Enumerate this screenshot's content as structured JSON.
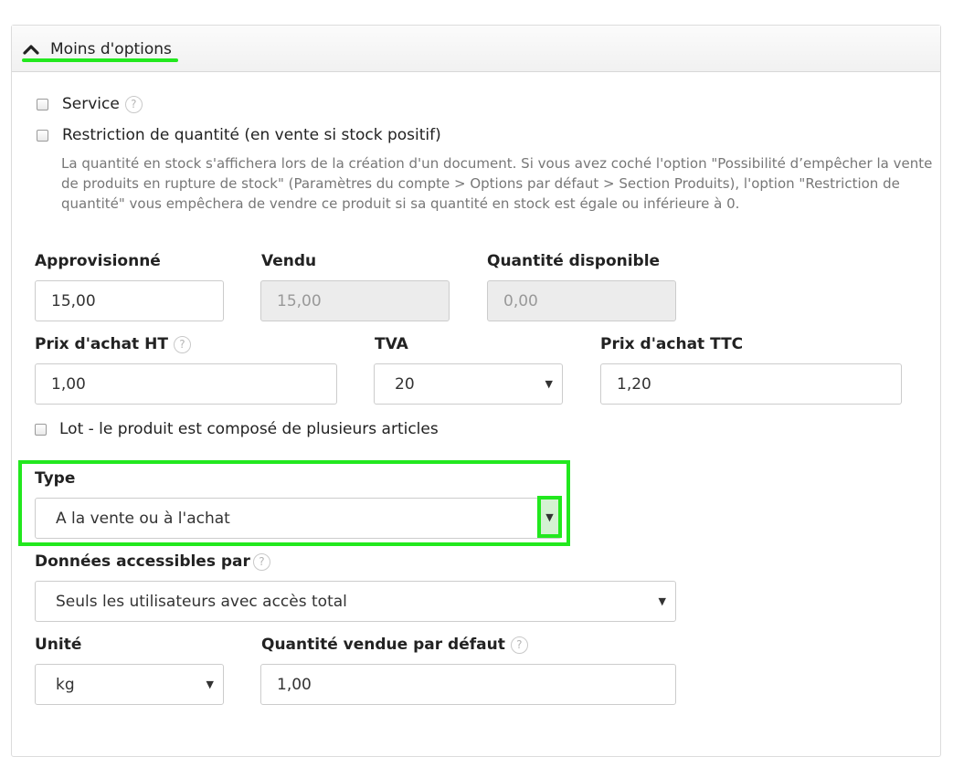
{
  "header": {
    "toggle_label": "Moins d'options"
  },
  "checkboxes": {
    "service": "Service",
    "restriction": "Restriction de quantité (en vente si stock positif)",
    "lot": "Lot - le produit est composé de plusieurs articles"
  },
  "help_glyph": "?",
  "description": "La quantité en stock s'affichera lors de la création d'un document. Si vous avez coché l'option \"Possibilité d’empêcher la vente de produits en rupture de stock\" (Paramètres du compte > Options par défaut > Section Produits), l'option \"Restriction de quantité\" vous empêchera de vendre ce produit si sa quantité en stock est égale ou inférieure à 0.",
  "fields": {
    "approvisionne": {
      "label": "Approvisionné",
      "value": "15,00"
    },
    "vendu": {
      "label": "Vendu",
      "value": "15,00"
    },
    "quantite_disponible": {
      "label": "Quantité disponible",
      "value": "0,00"
    },
    "prix_achat_ht": {
      "label": "Prix d'achat HT",
      "value": "1,00"
    },
    "tva": {
      "label": "TVA",
      "value": "20"
    },
    "prix_achat_ttc": {
      "label": "Prix d'achat TTC",
      "value": "1,20"
    },
    "type": {
      "label": "Type",
      "value": "A la vente ou à l'achat"
    },
    "donnees": {
      "label": "Données accessibles par",
      "value": "Seuls les utilisateurs avec accès total"
    },
    "unite": {
      "label": "Unité",
      "value": "kg"
    },
    "quantite_vendue": {
      "label": "Quantité vendue par défaut",
      "value": "1,00"
    }
  },
  "select_arrow": "▼",
  "colors": {
    "highlight": "#22e81e",
    "panel_border": "#dcdcdc",
    "disabled_bg": "#ececec"
  },
  "icons": {
    "toggle": "chevron-up-icon",
    "help": "help-circle-icon",
    "dropdown": "dropdown-arrow-icon"
  }
}
